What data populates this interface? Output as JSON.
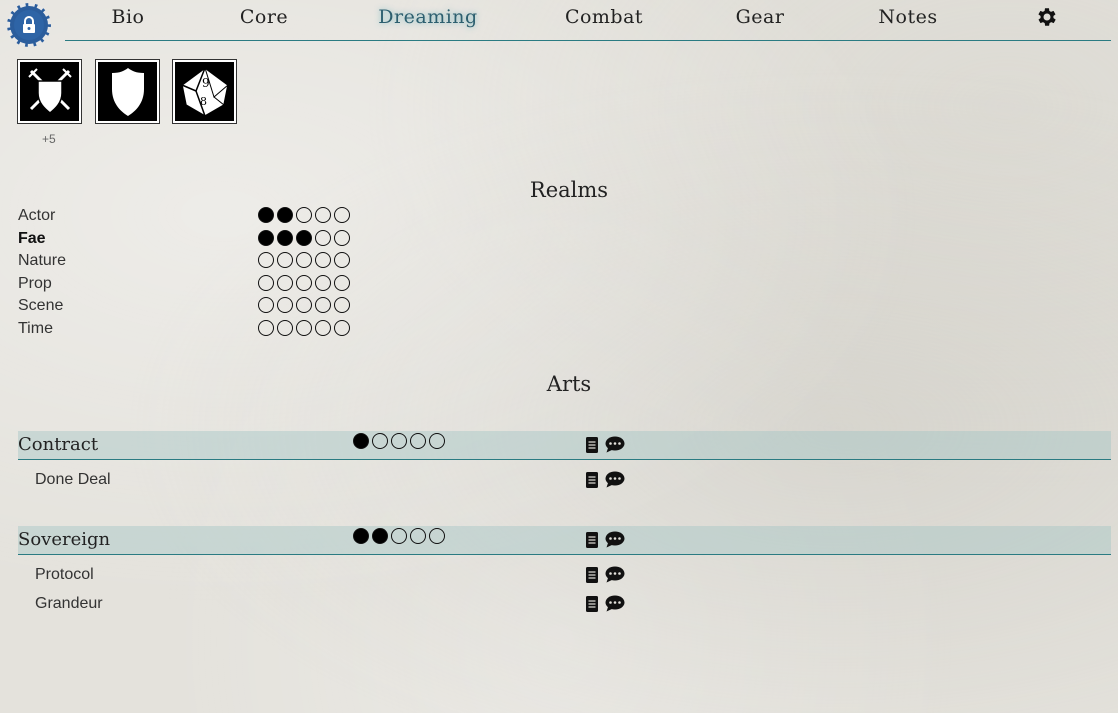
{
  "nav": {
    "tabs": [
      {
        "label": "Bio"
      },
      {
        "label": "Core"
      },
      {
        "label": "Dreaming"
      },
      {
        "label": "Combat"
      },
      {
        "label": "Gear"
      },
      {
        "label": "Notes"
      }
    ],
    "active_tab": "Dreaming",
    "settings_icon": "gear-icon",
    "lock_icon": "lock-icon"
  },
  "quick_icons": [
    {
      "icon": "crossed-swords-shield-icon",
      "modifier": "+5"
    },
    {
      "icon": "shield-icon"
    },
    {
      "icon": "d10-die-icon"
    }
  ],
  "realms": {
    "title": "Realms",
    "max_dots": 5,
    "items": [
      {
        "label": "Actor",
        "value": 2,
        "bold": false
      },
      {
        "label": "Fae",
        "value": 3,
        "bold": true
      },
      {
        "label": "Nature",
        "value": 0,
        "bold": false
      },
      {
        "label": "Prop",
        "value": 0,
        "bold": false
      },
      {
        "label": "Scene",
        "value": 0,
        "bold": false
      },
      {
        "label": "Time",
        "value": 0,
        "bold": false
      }
    ]
  },
  "arts": {
    "title": "Arts",
    "max_dots": 5,
    "items": [
      {
        "name": "Contract",
        "value": 1,
        "bindings": [
          "Done Deal"
        ]
      },
      {
        "name": "Sovereign",
        "value": 2,
        "bindings": [
          "Protocol",
          "Grandeur"
        ]
      }
    ]
  },
  "colors": {
    "accent": "#2a7b82",
    "header_band": "#a0c3c3",
    "lock_badge": "#2b5d9c",
    "active_tab_glow": "#50aab9"
  }
}
